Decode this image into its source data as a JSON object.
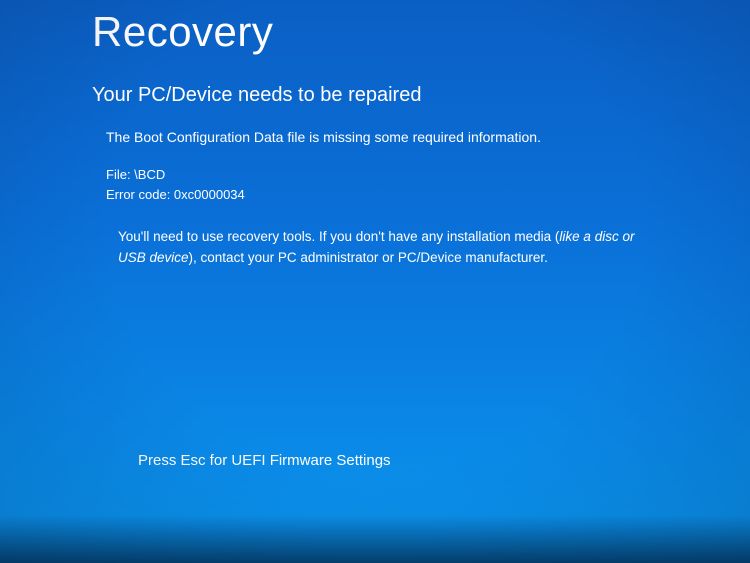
{
  "recovery": {
    "title": "Recovery",
    "subtitle": "Your PC/Device needs to be repaired",
    "error_description": "The Boot Configuration Data file is missing some required information.",
    "file_label": "File: ",
    "file_value": "\\BCD",
    "error_code_label": "Error code: ",
    "error_code_value": "0xc0000034",
    "instructions_part1": "You'll need to use recovery tools. If you don't have any installation media (",
    "instructions_italic": "like a disc or USB device",
    "instructions_part2": "), contact your PC administrator or PC/Device manufacturer.",
    "esc_prompt": "Press Esc for UEFI Firmware Settings"
  }
}
